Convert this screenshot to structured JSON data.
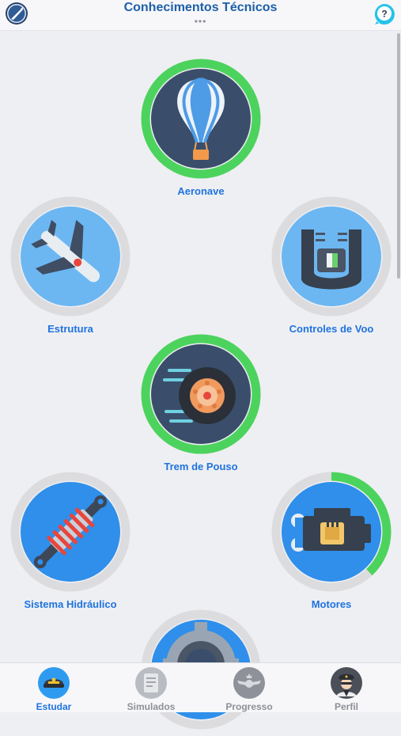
{
  "header": {
    "title": "Conhecimentos Técnicos",
    "more_dots": "•••",
    "logo_icon": "app-logo-icon",
    "help_icon": "help-icon",
    "help_glyph": "?"
  },
  "topics": [
    {
      "label": "Aeronave",
      "progress": 1.0,
      "icon": "hot-air-balloon-icon"
    },
    {
      "label": "Estrutura",
      "progress": 0.0,
      "icon": "airplane-icon"
    },
    {
      "label": "Controles de Voo",
      "progress": 0.0,
      "icon": "flight-controls-icon"
    },
    {
      "label": "Trem de Pouso",
      "progress": 1.0,
      "icon": "landing-gear-wheel-icon"
    },
    {
      "label": "Sistema Hidráulico",
      "progress": 0.0,
      "icon": "shock-absorber-icon"
    },
    {
      "label": "Motores",
      "progress": 0.38,
      "icon": "engine-icon"
    },
    {
      "label": "",
      "progress": 0.0,
      "icon": "gear-icon"
    }
  ],
  "tabs": [
    {
      "label": "Estudar",
      "active": true,
      "icon": "pilot-hat-icon"
    },
    {
      "label": "Simulados",
      "active": false,
      "icon": "exam-sheet-icon"
    },
    {
      "label": "Progresso",
      "active": false,
      "icon": "wings-badge-icon"
    },
    {
      "label": "Perfil",
      "active": false,
      "icon": "pilot-avatar-icon"
    }
  ],
  "colors": {
    "accent": "#1f73e0",
    "title": "#1d5fa8",
    "progress_ring": "#4cd35e",
    "ring_track": "#dcdcdf",
    "disc_dark": "#3a4e6b",
    "disc_light": "#6cb7f2"
  }
}
